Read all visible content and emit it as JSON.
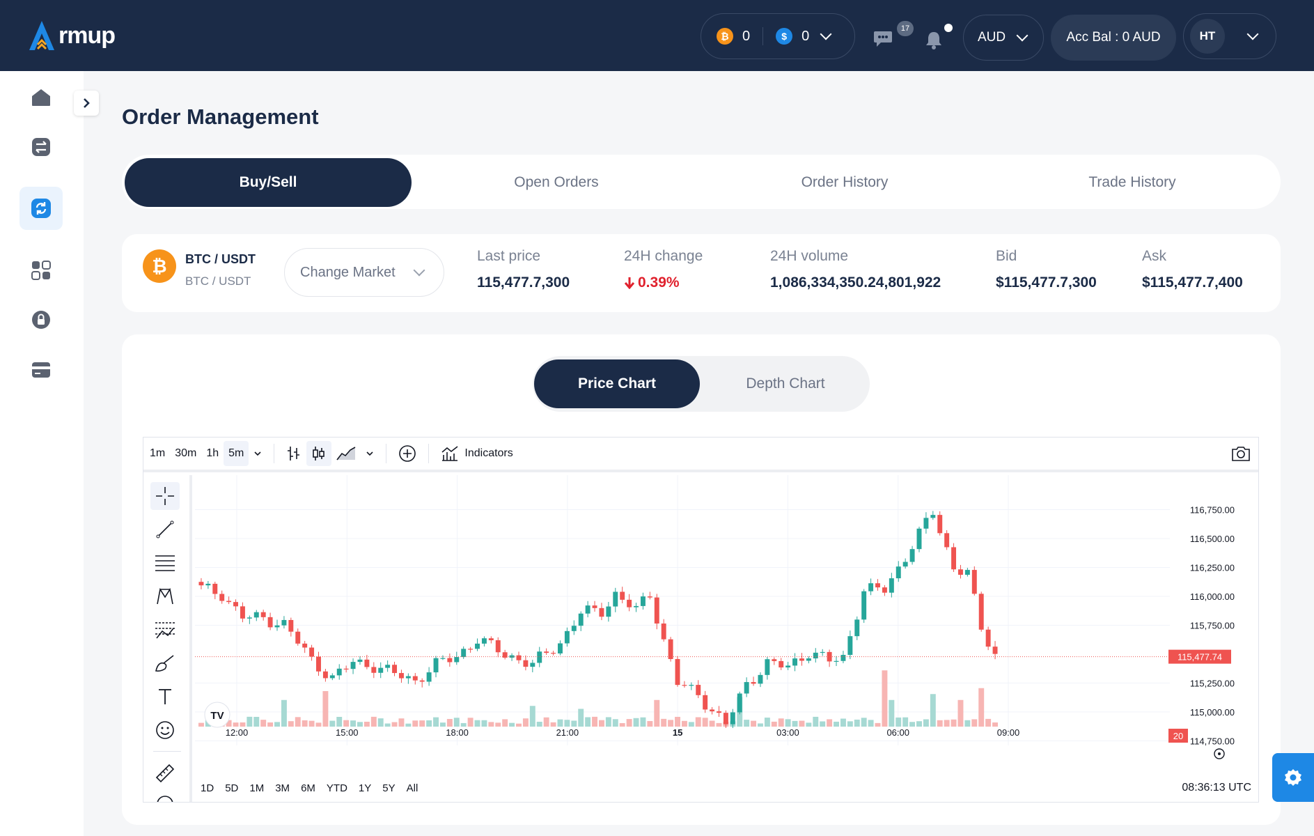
{
  "brand": {
    "logo_text": "rmup"
  },
  "header": {
    "wallet": {
      "btc_symbol": "₿",
      "btc_balance": "0",
      "usd_symbol": "$",
      "usd_balance": "0"
    },
    "messages_badge": "17",
    "currency": "AUD",
    "account_balance": "Acc Bal : 0 AUD",
    "user_initials": "HT"
  },
  "page": {
    "title": "Order Management"
  },
  "tabs": [
    {
      "label": "Buy/Sell",
      "active": true
    },
    {
      "label": "Open Orders",
      "active": false
    },
    {
      "label": "Order History",
      "active": false
    },
    {
      "label": "Trade History",
      "active": false
    }
  ],
  "market": {
    "pair": "BTC / USDT",
    "pair_sub": "BTC / USDT",
    "change_market_label": "Change Market",
    "stats": [
      {
        "label": "Last price",
        "value": "115,477.7,300"
      },
      {
        "label": "24H change",
        "value": "0.39%",
        "direction": "down"
      },
      {
        "label": "24H volume",
        "value": "1,086,334,350.24,801,922"
      },
      {
        "label": "Bid",
        "value": "$115,477.7,300"
      },
      {
        "label": "Ask",
        "value": "$115,477.7,400"
      }
    ]
  },
  "chart_tabs": [
    {
      "label": "Price Chart",
      "active": true
    },
    {
      "label": "Depth Chart",
      "active": false
    }
  ],
  "tv_toolbar": {
    "timeframes": [
      "1m",
      "30m",
      "1h",
      "5m"
    ],
    "selected_timeframe": "5m",
    "indicators_label": "Indicators"
  },
  "tv_bottom": {
    "ranges": [
      "1D",
      "5D",
      "1M",
      "3M",
      "6M",
      "YTD",
      "1Y",
      "5Y",
      "All"
    ],
    "clock": "08:36:13 UTC"
  },
  "colors": {
    "up": "#26a69a",
    "down": "#ef5350",
    "navy": "#1b2b47",
    "accent": "#1e88e5"
  },
  "chart_data": {
    "type": "candlestick",
    "x_ticks": [
      "12:00",
      "15:00",
      "18:00",
      "21:00",
      "15",
      "03:00",
      "06:00",
      "09:00"
    ],
    "y_ticks": [
      "116,750.00",
      "116,500.00",
      "116,250.00",
      "116,000.00",
      "115,750.00",
      "115,250.00",
      "115,000.00",
      "114,750.00"
    ],
    "ylim": [
      114650,
      117000
    ],
    "last_price_label": "115,477.74",
    "last_price": 115477.74,
    "volume_label": "20",
    "close_path": [
      [
        0,
        116070
      ],
      [
        3,
        116020
      ],
      [
        6,
        115820
      ],
      [
        9,
        115810
      ],
      [
        12,
        115760
      ],
      [
        16,
        115450
      ],
      [
        19,
        115290
      ],
      [
        22,
        115430
      ],
      [
        25,
        115400
      ],
      [
        28,
        115330
      ],
      [
        31,
        115270
      ],
      [
        34,
        115410
      ],
      [
        37,
        115480
      ],
      [
        40,
        115630
      ],
      [
        44,
        115500
      ],
      [
        48,
        115410
      ],
      [
        52,
        115600
      ],
      [
        55,
        115860
      ],
      [
        58,
        115870
      ],
      [
        60,
        116020
      ],
      [
        63,
        115880
      ],
      [
        65,
        116020
      ],
      [
        67,
        115620
      ],
      [
        69,
        115250
      ],
      [
        72,
        115150
      ],
      [
        74,
        115020
      ],
      [
        76,
        114890
      ],
      [
        79,
        115240
      ],
      [
        82,
        115420
      ],
      [
        85,
        115390
      ],
      [
        88,
        115520
      ],
      [
        91,
        115440
      ],
      [
        93,
        115470
      ],
      [
        96,
        116050
      ],
      [
        99,
        116060
      ],
      [
        102,
        116340
      ],
      [
        106,
        116730
      ],
      [
        109,
        116250
      ],
      [
        111,
        116200
      ],
      [
        113,
        115720
      ],
      [
        115,
        115500
      ]
    ],
    "close_path_note_units": "pairs are [5-minute bar index, close price in USDT]",
    "volume_spike_bars": [
      [
        12,
        0.45
      ],
      [
        18,
        0.6
      ],
      [
        48,
        0.35
      ],
      [
        55,
        0.3
      ],
      [
        66,
        0.45
      ],
      [
        78,
        0.5
      ],
      [
        99,
        0.95
      ],
      [
        100,
        0.45
      ],
      [
        106,
        0.55
      ],
      [
        110,
        0.45
      ],
      [
        113,
        0.65
      ]
    ]
  }
}
